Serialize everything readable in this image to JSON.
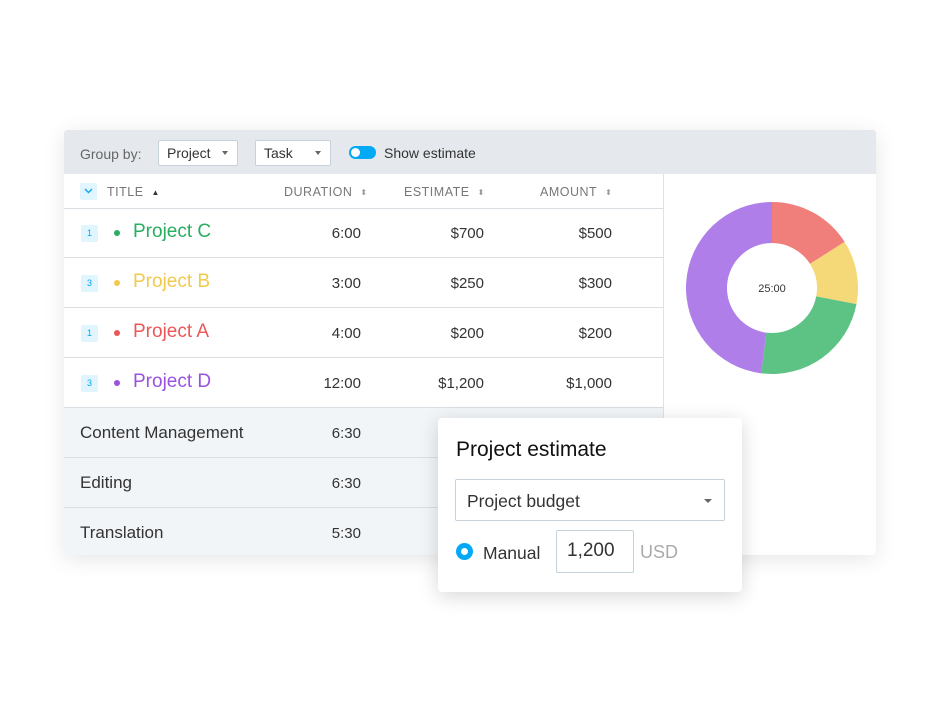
{
  "toolbar": {
    "group_by_label": "Group by:",
    "group_select_1": "Project",
    "group_select_2": "Task",
    "toggle_label": "Show estimate",
    "toggle_on": true
  },
  "table": {
    "headers": {
      "title": "TITLE",
      "duration": "DURATION",
      "estimate": "ESTIMATE",
      "amount": "AMOUNT"
    },
    "projects": [
      {
        "badge": "1",
        "name": "Project C",
        "color": "#27ae60",
        "duration": "6:00",
        "estimate": "$700",
        "amount": "$500"
      },
      {
        "badge": "3",
        "name": "Project B",
        "color": "#f2c94c",
        "duration": "3:00",
        "estimate": "$250",
        "amount": "$300"
      },
      {
        "badge": "1",
        "name": "Project A",
        "color": "#eb5757",
        "duration": "4:00",
        "estimate": "$200",
        "amount": "$200"
      },
      {
        "badge": "3",
        "name": "Project D",
        "color": "#9b51e0",
        "duration": "12:00",
        "estimate": "$1,200",
        "amount": "$1,000"
      }
    ],
    "groups": [
      {
        "name": "Content Management",
        "duration": "6:30"
      },
      {
        "name": "Editing",
        "duration": "6:30"
      },
      {
        "name": "Translation",
        "duration": "5:30"
      }
    ]
  },
  "chart_data": {
    "type": "pie",
    "center_label": "25:00",
    "slices": [
      {
        "value": 4,
        "color": "#f07e7b"
      },
      {
        "value": 3,
        "color": "#f5d878"
      },
      {
        "value": 6,
        "color": "#5dc384"
      },
      {
        "value": 12,
        "color": "#b07ee8"
      }
    ]
  },
  "popup": {
    "title": "Project estimate",
    "select_value": "Project budget",
    "radio_label": "Manual",
    "amount_value": "1,200",
    "currency": "USD"
  }
}
